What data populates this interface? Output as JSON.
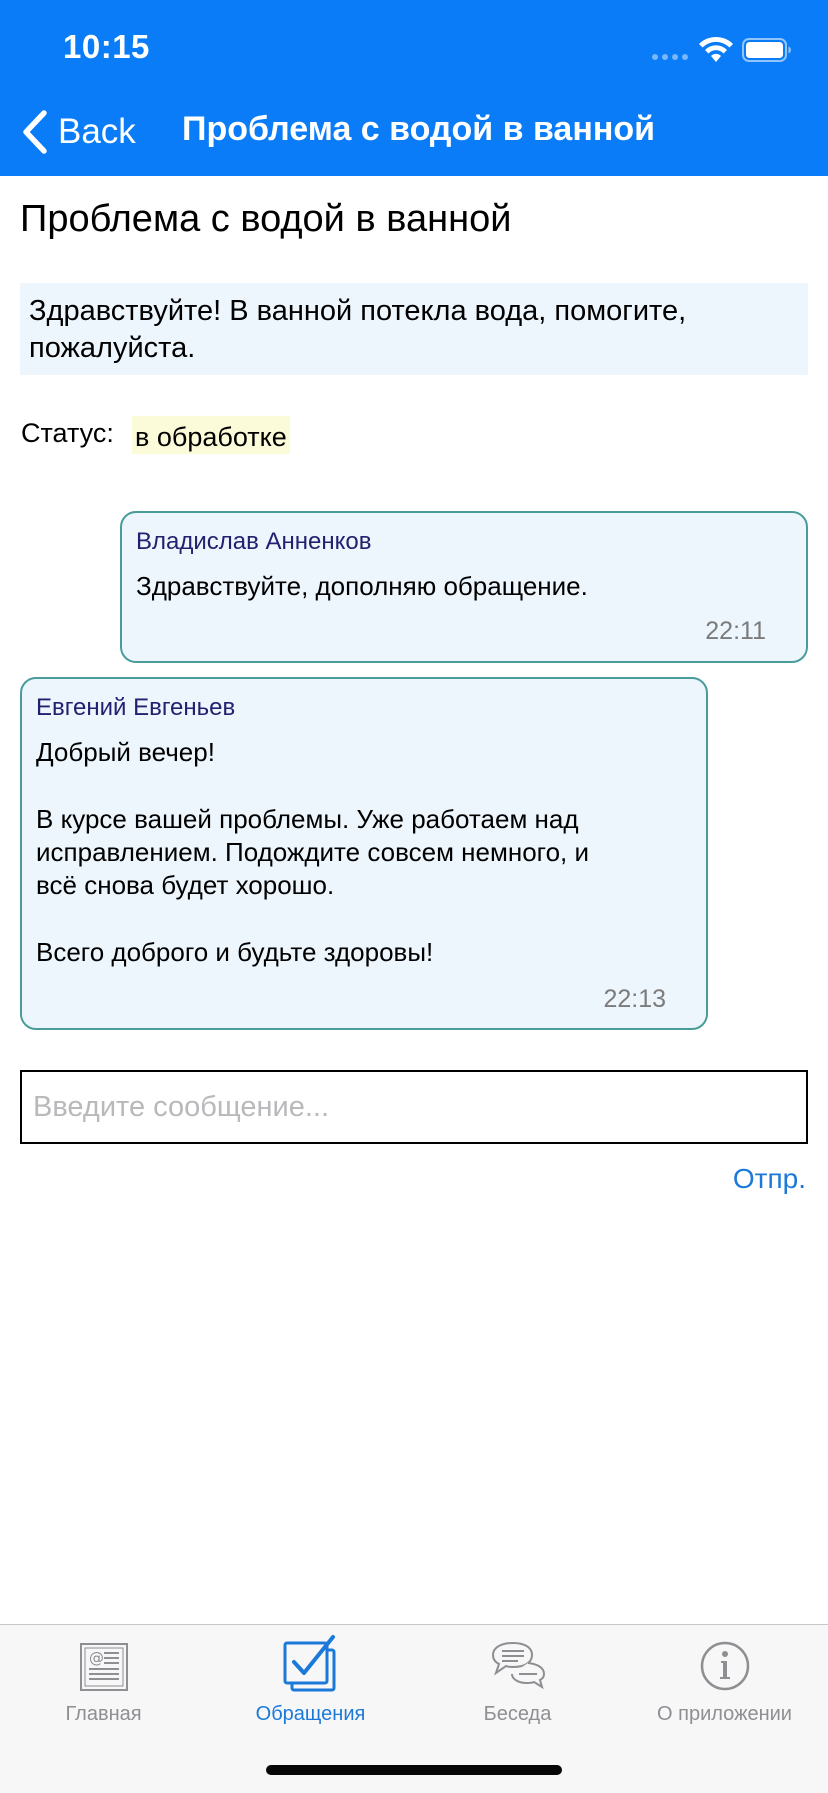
{
  "status_bar": {
    "time": "10:15"
  },
  "nav": {
    "back_label": "Back",
    "title": "Проблема с водой в ванной"
  },
  "ticket": {
    "title": "Проблема с водой в ванной",
    "description_lines": [
      "Здравствуйте! В ванной потекла вода, помогите,",
      "пожалуйста."
    ],
    "status_label": "Статус:",
    "status_value": "в обработке"
  },
  "messages": [
    {
      "author": "Владислав Анненков",
      "lines": [
        "Здравствуйте, дополняю обращение."
      ],
      "time": "22:11"
    },
    {
      "author": "Евгений Евгеньев",
      "lines": [
        "Добрый вечер!",
        "",
        "В курсе вашей проблемы. Уже работаем над",
        "исправлением. Подождите совсем немного, и",
        "всё снова будет хорошо.",
        "",
        "Всего доброго и будьте здоровы!"
      ],
      "time": "22:13"
    }
  ],
  "composer": {
    "placeholder": "Введите сообщение...",
    "send_label": "Отпр."
  },
  "tabbar": {
    "tabs": [
      {
        "label": "Главная",
        "icon": "newspaper-icon",
        "active": false
      },
      {
        "label": "Обращения",
        "icon": "checkbox-icon",
        "active": true
      },
      {
        "label": "Беседа",
        "icon": "chat-bubbles-icon",
        "active": false
      },
      {
        "label": "О приложении",
        "icon": "info-icon",
        "active": false
      }
    ]
  },
  "colors": {
    "header_bg": "#0a7cf7",
    "accent": "#1b7ad9",
    "bubble_bg": "#eef6fd",
    "bubble_border": "#4a9c9a",
    "status_badge_bg": "#fbfad9"
  }
}
